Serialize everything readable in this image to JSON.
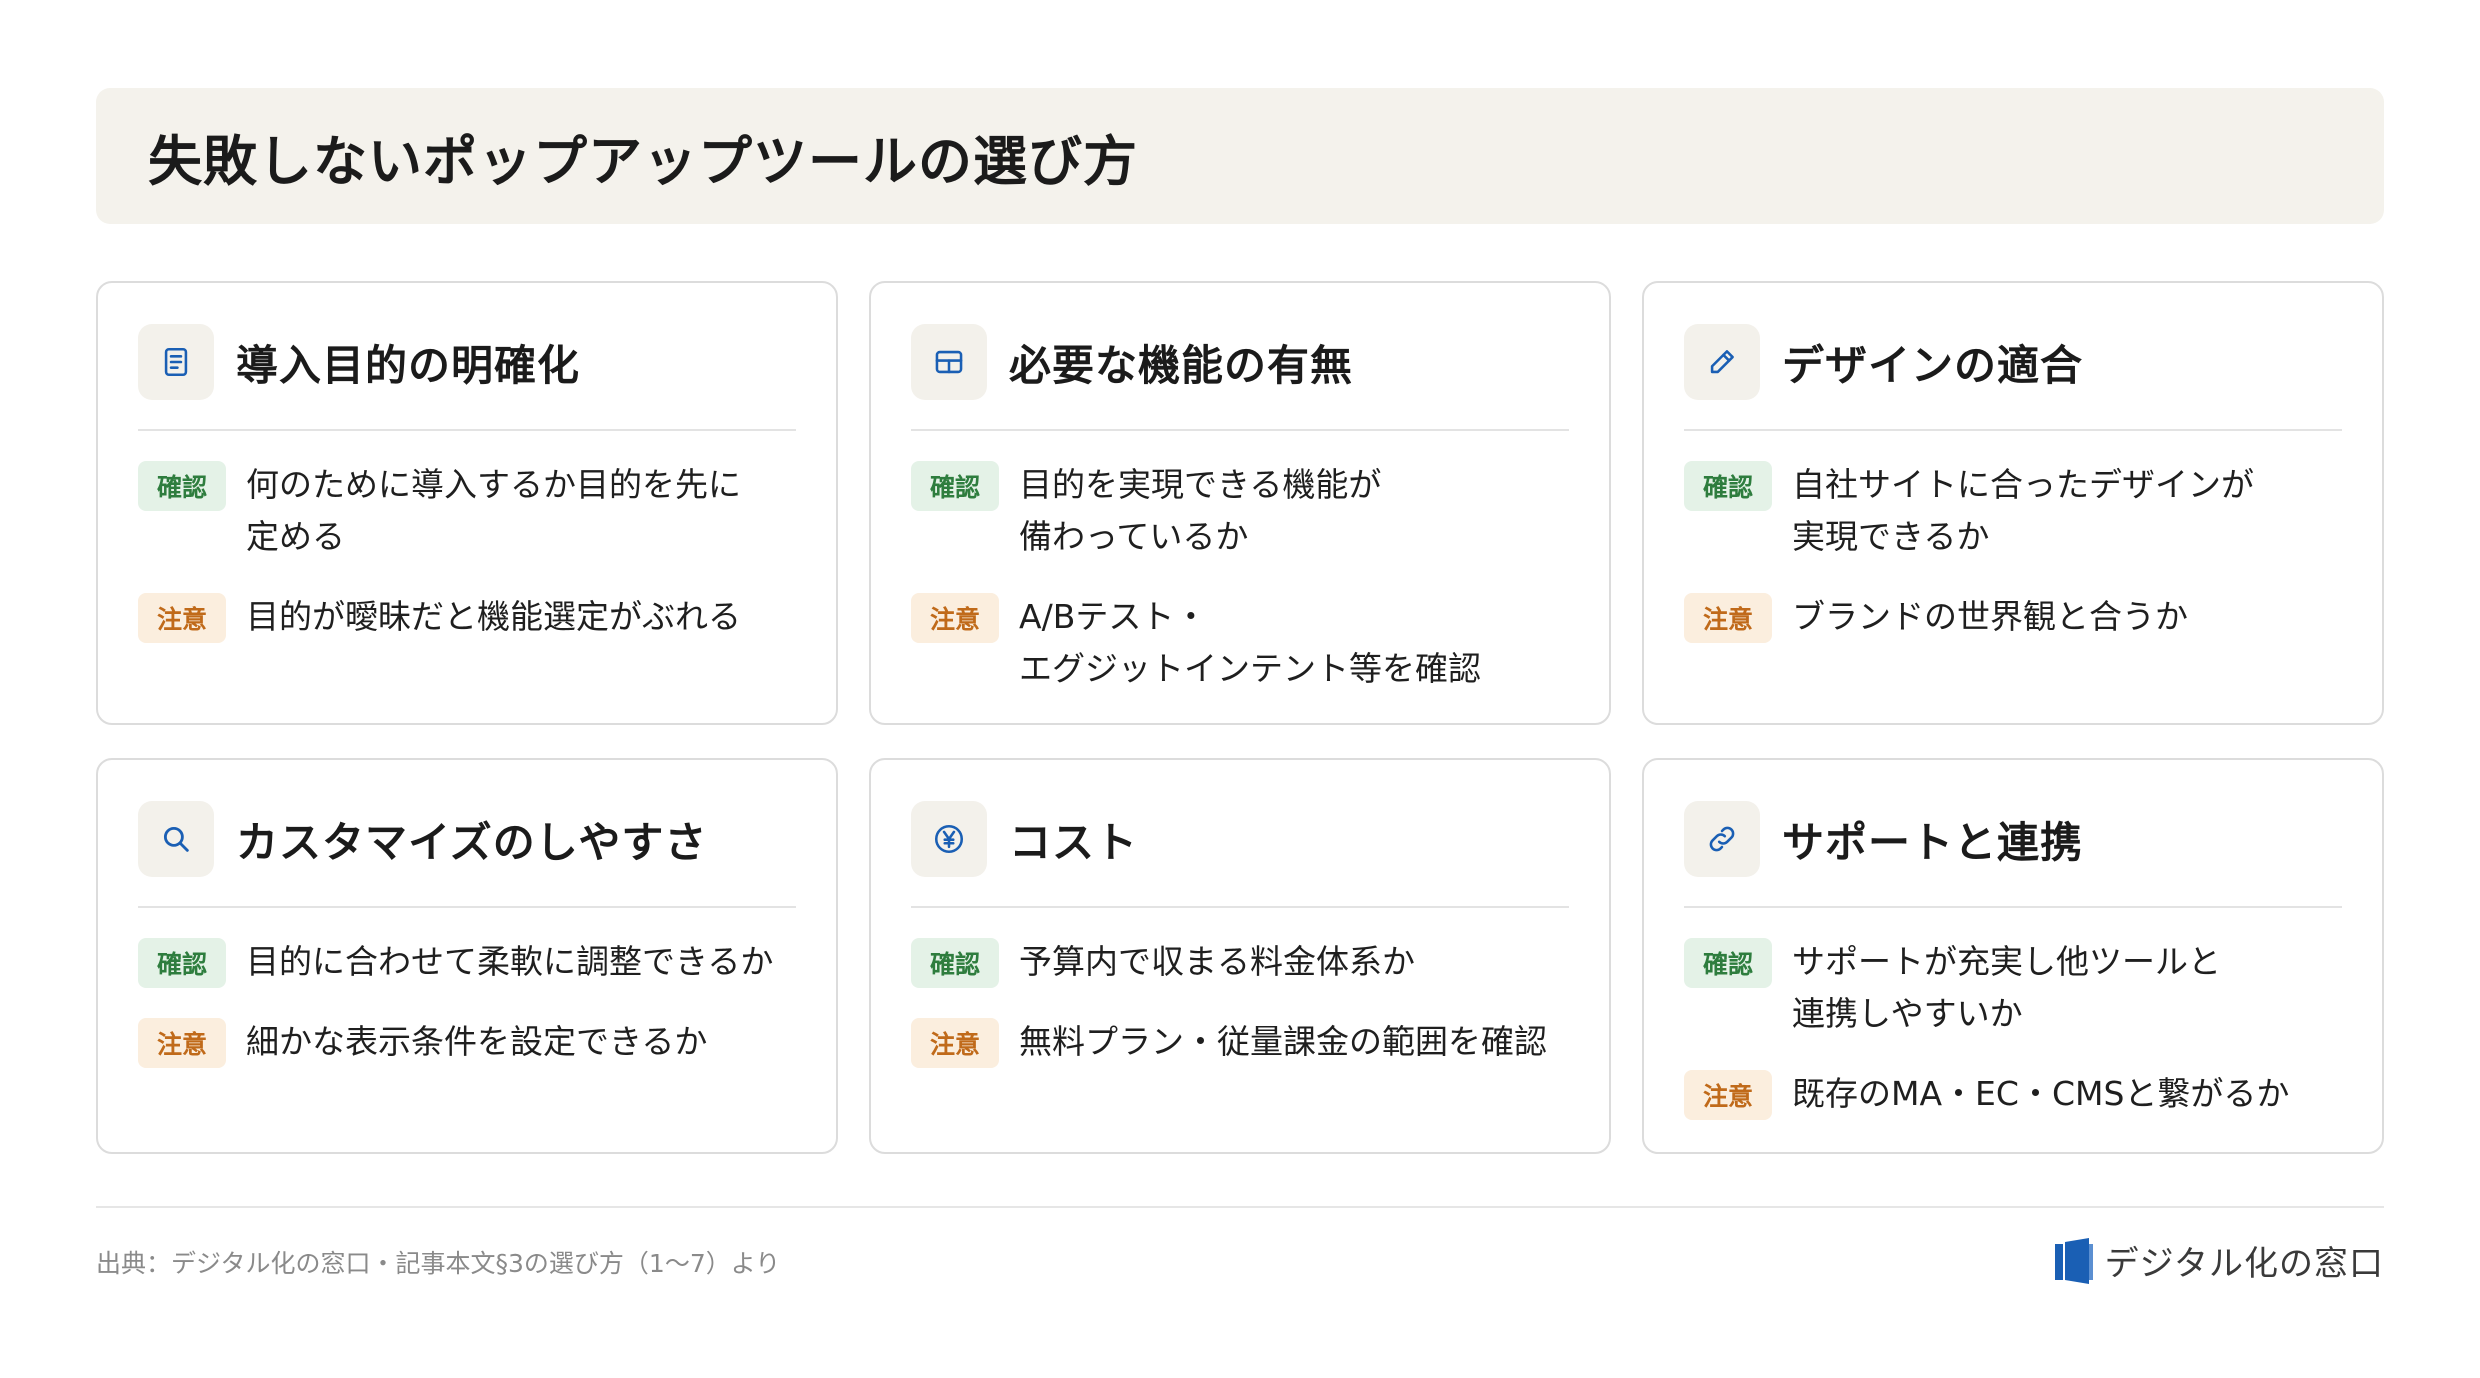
{
  "title": "失敗しないポップアップツールの選び方",
  "colors": {
    "accent": "#1a5fb4",
    "ok_bg": "#e4f2e7",
    "ok_fg": "#2e7d3e",
    "warn_bg": "#fbeede",
    "warn_fg": "#c06a1a",
    "title_bg": "#f4f2ec"
  },
  "cards": [
    {
      "icon": "document-icon",
      "title": "導入目的の明確化",
      "rows": [
        {
          "badge": "確認",
          "text": "何のために導入するか目的を先に\n定める"
        },
        {
          "badge": "注意",
          "text": "目的が曖昧だと機能選定がぶれる"
        }
      ]
    },
    {
      "icon": "grid-icon",
      "title": "必要な機能の有無",
      "rows": [
        {
          "badge": "確認",
          "text": "目的を実現できる機能が\n備わっているか"
        },
        {
          "badge": "注意",
          "text": "A/Bテスト・\nエグジットインテント等を確認"
        }
      ]
    },
    {
      "icon": "pencil-icon",
      "title": "デザインの適合",
      "rows": [
        {
          "badge": "確認",
          "text": "自社サイトに合ったデザインが\n実現できるか"
        },
        {
          "badge": "注意",
          "text": "ブランドの世界観と合うか"
        }
      ]
    },
    {
      "icon": "search-icon",
      "title": "カスタマイズのしやすさ",
      "rows": [
        {
          "badge": "確認",
          "text": "目的に合わせて柔軟に調整できるか"
        },
        {
          "badge": "注意",
          "text": "細かな表示条件を設定できるか"
        }
      ]
    },
    {
      "icon": "yen-icon",
      "title": "コスト",
      "rows": [
        {
          "badge": "確認",
          "text": "予算内で収まる料金体系か"
        },
        {
          "badge": "注意",
          "text": "無料プラン・従量課金の範囲を確認"
        }
      ]
    },
    {
      "icon": "link-icon",
      "title": "サポートと連携",
      "rows": [
        {
          "badge": "確認",
          "text": "サポートが充実し他ツールと\n連携しやすいか"
        },
        {
          "badge": "注意",
          "text": "既存のMA・EC・CMSと繋がるか"
        }
      ]
    }
  ],
  "footer": {
    "source": "出典：デジタル化の窓口・記事本文§3の選び方（1〜7）より",
    "logo_text": "デジタル化の窓口"
  }
}
